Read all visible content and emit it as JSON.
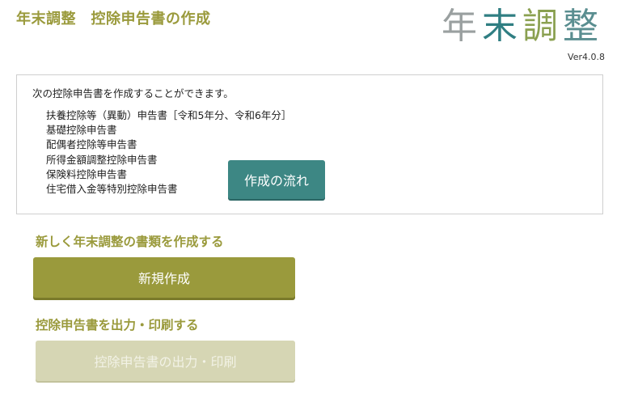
{
  "header": {
    "title": "年末調整　控除申告書の作成",
    "logo": {
      "chars": [
        "年",
        "末",
        "調",
        "整"
      ],
      "colors": [
        "#9aa0a0",
        "#2f7e82",
        "#8aa050",
        "#5a8e90"
      ]
    },
    "version": "Ver4.0.8"
  },
  "info": {
    "intro": "次の控除申告書を作成することができます。",
    "forms": [
      "扶養控除等（異動）申告書［令和5年分、令和6年分］",
      "基礎控除申告書",
      "配偶者控除等申告書",
      "所得金額調整控除申告書",
      "保険料控除申告書",
      "住宅借入金等特別控除申告書"
    ],
    "flow_button_label": "作成の流れ"
  },
  "new_section": {
    "heading": "新しく年末調整の書類を作成する",
    "button_label": "新規作成"
  },
  "print_section": {
    "heading": "控除申告書を出力・印刷する",
    "button_label": "控除申告書の出力・印刷",
    "button_enabled": false
  },
  "colors": {
    "accent_olive": "#9a9a3c",
    "accent_teal": "#3d8784",
    "disabled": "#d6d6b4"
  }
}
